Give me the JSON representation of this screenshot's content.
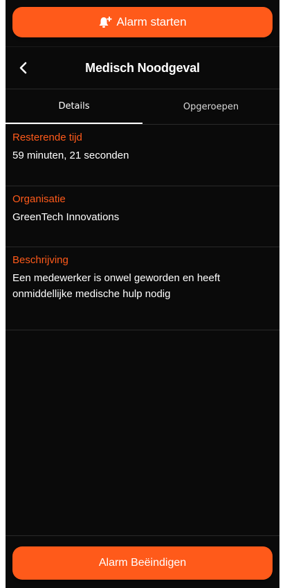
{
  "top_button": {
    "label": "Alarm starten",
    "icon": "bell-plus-icon"
  },
  "header": {
    "title": "Medisch Noodgeval",
    "back_icon": "chevron-left-icon"
  },
  "tabs": [
    {
      "label": "Details",
      "active": true
    },
    {
      "label": "Opgeroepen",
      "active": false
    }
  ],
  "details": {
    "remaining_time": {
      "label": "Resterende tijd",
      "value": "59 minuten, 21 seconden"
    },
    "organisation": {
      "label": "Organisatie",
      "value": "GreenTech Innovations"
    },
    "description": {
      "label": "Beschrijving",
      "value": "Een medewerker is onwel geworden en heeft onmiddellijke medische hulp nodig"
    }
  },
  "bottom_button": {
    "label": "Alarm Beëindigen"
  },
  "colors": {
    "accent": "#ff5a1a",
    "background": "#0a0a0a",
    "text": "#ffffff"
  }
}
